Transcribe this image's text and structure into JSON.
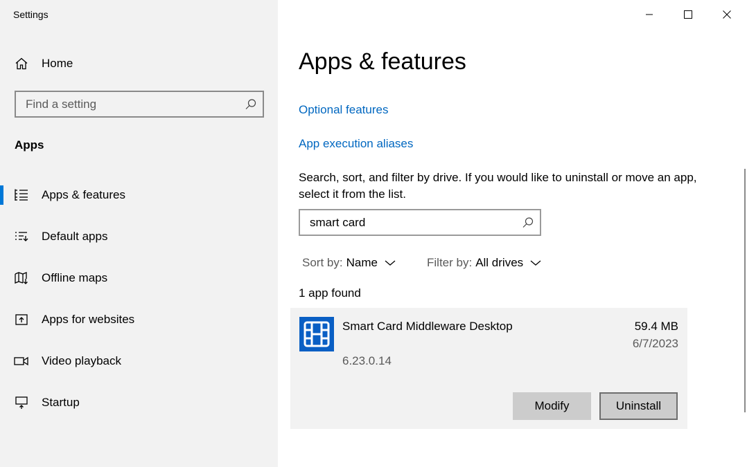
{
  "window": {
    "title": "Settings"
  },
  "sidebar": {
    "home_label": "Home",
    "search": {
      "placeholder": "Find a setting",
      "value": ""
    },
    "section_title": "Apps",
    "items": [
      {
        "label": "Apps & features",
        "icon": "apps-features-icon",
        "active": true
      },
      {
        "label": "Default apps",
        "icon": "default-apps-icon",
        "active": false
      },
      {
        "label": "Offline maps",
        "icon": "offline-maps-icon",
        "active": false
      },
      {
        "label": "Apps for websites",
        "icon": "apps-for-websites-icon",
        "active": false
      },
      {
        "label": "Video playback",
        "icon": "video-playback-icon",
        "active": false
      },
      {
        "label": "Startup",
        "icon": "startup-icon",
        "active": false
      }
    ]
  },
  "main": {
    "title": "Apps & features",
    "links": {
      "optional_features": "Optional features",
      "app_execution_aliases": "App execution aliases"
    },
    "description": "Search, sort, and filter by drive. If you would like to uninstall or move an app, select it from the list.",
    "search": {
      "value": "smart card",
      "placeholder": ""
    },
    "sort": {
      "key": "Sort by:",
      "value": "Name"
    },
    "filter": {
      "key": "Filter by:",
      "value": "All drives"
    },
    "result_count": "1 app found",
    "apps": [
      {
        "name": "Smart Card Middleware Desktop",
        "size": "59.4 MB",
        "date": "6/7/2023",
        "version": "6.23.0.14",
        "modify_label": "Modify",
        "uninstall_label": "Uninstall"
      }
    ]
  },
  "colors": {
    "accent": "#0078d7",
    "link": "#0067c0",
    "sidebar_bg": "#f2f2f2",
    "app_icon_bg": "#0a5fc4"
  }
}
